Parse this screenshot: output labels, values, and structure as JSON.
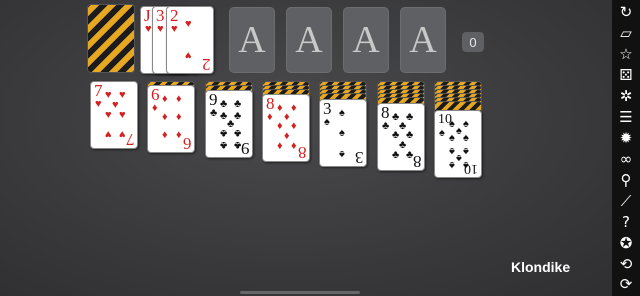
{
  "app": {
    "game_name": "Klondike",
    "score": "0"
  },
  "stock": {
    "face_down": true
  },
  "waste": [
    {
      "rank": "J",
      "suit": "♥",
      "color": "red"
    },
    {
      "rank": "3",
      "suit": "♥",
      "color": "red"
    },
    {
      "rank": "2",
      "suit": "♥",
      "color": "red"
    }
  ],
  "foundations": [
    {
      "label": "A"
    },
    {
      "label": "A"
    },
    {
      "label": "A"
    },
    {
      "label": "A"
    }
  ],
  "tableau": [
    {
      "face_down": 0,
      "card": {
        "rank": "7",
        "suit": "♥",
        "color": "red"
      }
    },
    {
      "face_down": 1,
      "card": {
        "rank": "6",
        "suit": "♦",
        "color": "red"
      }
    },
    {
      "face_down": 2,
      "card": {
        "rank": "9",
        "suit": "♣",
        "color": "black"
      }
    },
    {
      "face_down": 3,
      "card": {
        "rank": "8",
        "suit": "♦",
        "color": "red"
      }
    },
    {
      "face_down": 4,
      "card": {
        "rank": "3",
        "suit": "♠",
        "color": "black"
      }
    },
    {
      "face_down": 5,
      "card": {
        "rank": "8",
        "suit": "♣",
        "color": "black"
      }
    },
    {
      "face_down": 6,
      "card": {
        "rank": "10",
        "suit": "♠",
        "color": "black"
      }
    }
  ],
  "toolbar": [
    {
      "name": "undo-icon",
      "glyph": "↻"
    },
    {
      "name": "cards-icon",
      "glyph": "▱"
    },
    {
      "name": "star-icon",
      "glyph": "☆"
    },
    {
      "name": "dice-icon",
      "glyph": "⚄"
    },
    {
      "name": "gear-icon",
      "glyph": "✲"
    },
    {
      "name": "list-icon",
      "glyph": "☰"
    },
    {
      "name": "lightbulb-icon",
      "glyph": "✹"
    },
    {
      "name": "glasses-icon",
      "glyph": "∞"
    },
    {
      "name": "magnifier-icon",
      "glyph": "⚲"
    },
    {
      "name": "stats-icon",
      "glyph": "⟋"
    },
    {
      "name": "help-icon",
      "glyph": "?"
    },
    {
      "name": "badge-icon",
      "glyph": "✪"
    },
    {
      "name": "redeal-icon",
      "glyph": "⟲"
    },
    {
      "name": "restart-icon",
      "glyph": "⟳"
    }
  ]
}
